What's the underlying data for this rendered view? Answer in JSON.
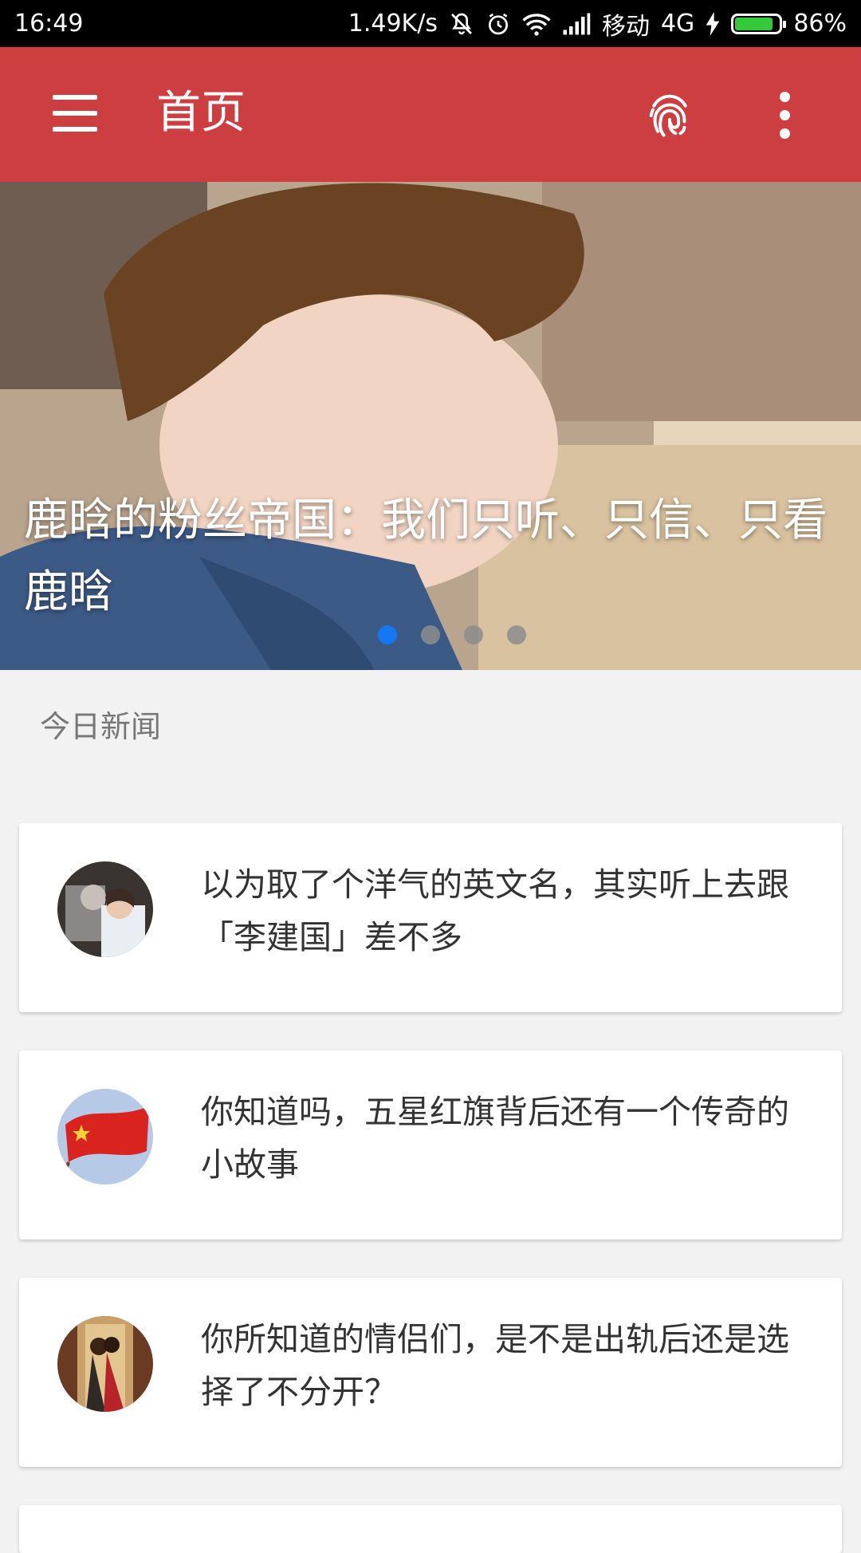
{
  "status_bar": {
    "time": "16:49",
    "speed": "1.49K/s",
    "carrier": "移动",
    "network": "4G",
    "battery": "86%",
    "battery_level": 0.86,
    "icons": [
      "mute-icon",
      "alarm-icon",
      "wifi-icon",
      "signal-icon",
      "charging-icon",
      "battery-icon"
    ]
  },
  "appbar": {
    "title": "首页",
    "icons": [
      "menu-icon",
      "fingerprint-icon",
      "more-vert-icon"
    ]
  },
  "banner": {
    "title": "鹿晗的粉丝帝国：我们只听、只信、只看鹿晗",
    "slide_count": 4,
    "active_index": 0,
    "accent": "#1677f2"
  },
  "section": {
    "label": "今日新闻"
  },
  "news": [
    {
      "title": "以为取了个洋气的英文名，其实听上去跟「李建国」差不多",
      "thumb": "couple-photo"
    },
    {
      "title": "你知道吗，五星红旗背后还有一个传奇的小故事",
      "thumb": "chinese-flag"
    },
    {
      "title": "你所知道的情侣们，是不是出轨后还是选择了不分开？",
      "thumb": "couple-embrace"
    }
  ],
  "colors": {
    "appbar": "#cd3e41",
    "background": "#f2f2f2",
    "card": "#ffffff",
    "battery_fill": "#34c93a"
  }
}
